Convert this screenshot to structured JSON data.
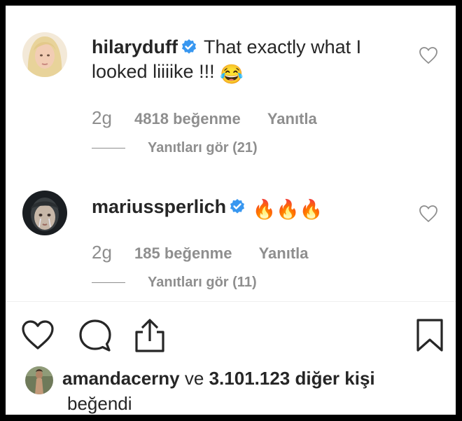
{
  "comments": [
    {
      "username": "hilaryduff",
      "text_line1": "That exactly what I",
      "text_line2": "looked liiiike !!!",
      "emoji": "😂",
      "time": "2g",
      "likes": "4818 beğenme",
      "reply_label": "Yanıtla",
      "view_replies": "Yanıtları gör (21)"
    },
    {
      "username": "mariussperlich",
      "text": "🔥🔥🔥",
      "time": "2g",
      "likes": "185 beğenme",
      "reply_label": "Yanıtla",
      "view_replies": "Yanıtları gör (11)"
    }
  ],
  "liked_by": {
    "username": "amandacerny",
    "connector": "ve",
    "others": "3.101.123 diğer kişi",
    "suffix": "beğendi"
  },
  "icons": {
    "verified": "verified-badge-icon",
    "comment_like": "heart-outline-icon",
    "like": "heart-icon",
    "comment": "comment-bubble-icon",
    "share": "share-icon",
    "save": "bookmark-icon"
  },
  "colors": {
    "text": "#262626",
    "secondary": "#8e8e8e",
    "verified": "#3897f0"
  }
}
